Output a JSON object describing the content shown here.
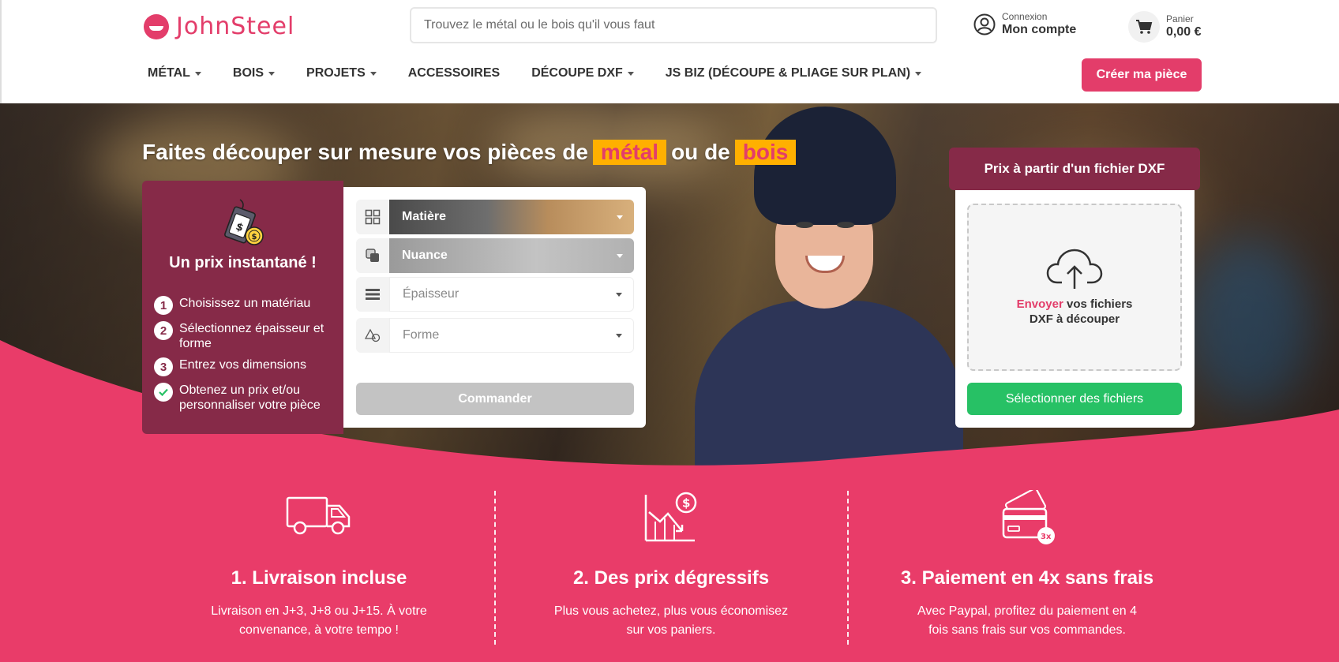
{
  "brand": {
    "name": "JohnSteel",
    "accent": "#e33d6a",
    "dark_accent": "#862a48",
    "success": "#27c165"
  },
  "search": {
    "placeholder": "Trouvez le métal ou le bois qu'il vous faut"
  },
  "account": {
    "small": "Connexion",
    "big": "Mon compte",
    "icon": "user-icon"
  },
  "cart": {
    "small": "Panier",
    "big": "0,00 €",
    "icon": "cart-icon"
  },
  "nav": {
    "items": [
      {
        "label": "MÉTAL",
        "dropdown": true
      },
      {
        "label": "BOIS",
        "dropdown": true
      },
      {
        "label": "PROJETS",
        "dropdown": true
      },
      {
        "label": "ACCESSOIRES",
        "dropdown": false
      },
      {
        "label": "DÉCOUPE DXF",
        "dropdown": true
      },
      {
        "label": "JS BIZ (DÉCOUPE & PLIAGE SUR PLAN)",
        "dropdown": true
      }
    ],
    "cta": "Créer ma pièce"
  },
  "hero": {
    "title_before": "Faites découper sur mesure vos pièces de",
    "title_metal": "métal",
    "title_middle": "ou de",
    "title_wood": "bois"
  },
  "info": {
    "title": "Un prix instantané !",
    "steps": [
      {
        "num": "1",
        "text": "Choisissez un matériau"
      },
      {
        "num": "2",
        "text": "Sélectionnez épaisseur et forme"
      },
      {
        "num": "3",
        "text": "Entrez vos dimensions"
      },
      {
        "num": "",
        "text": "Obtenez un prix et/ou personnaliser votre pièce"
      }
    ]
  },
  "config": {
    "matiere": "Matière",
    "nuance": "Nuance",
    "epaisseur": "Épaisseur",
    "forme": "Forme",
    "order": "Commander"
  },
  "dxf": {
    "header": "Prix à partir d'un fichier DXF",
    "drop_accent": "Envoyer",
    "drop_line1": "vos fichiers",
    "drop_line2": "DXF à découper",
    "button": "Sélectionner des fichiers"
  },
  "features": [
    {
      "icon": "truck-icon",
      "title": "1. Livraison incluse",
      "text": "Livraison en J+3, J+8 ou J+15. À votre convenance, à votre tempo !"
    },
    {
      "icon": "price-drop-icon",
      "title": "2. Des prix dégressifs",
      "text": "Plus vous achetez, plus vous économisez sur vos paniers."
    },
    {
      "icon": "card-3x-icon",
      "title": "3. Paiement en 4x sans frais",
      "text": "Avec Paypal, profitez du paiement en 4 fois sans frais sur vos commandes.",
      "badge": "3x"
    }
  ]
}
